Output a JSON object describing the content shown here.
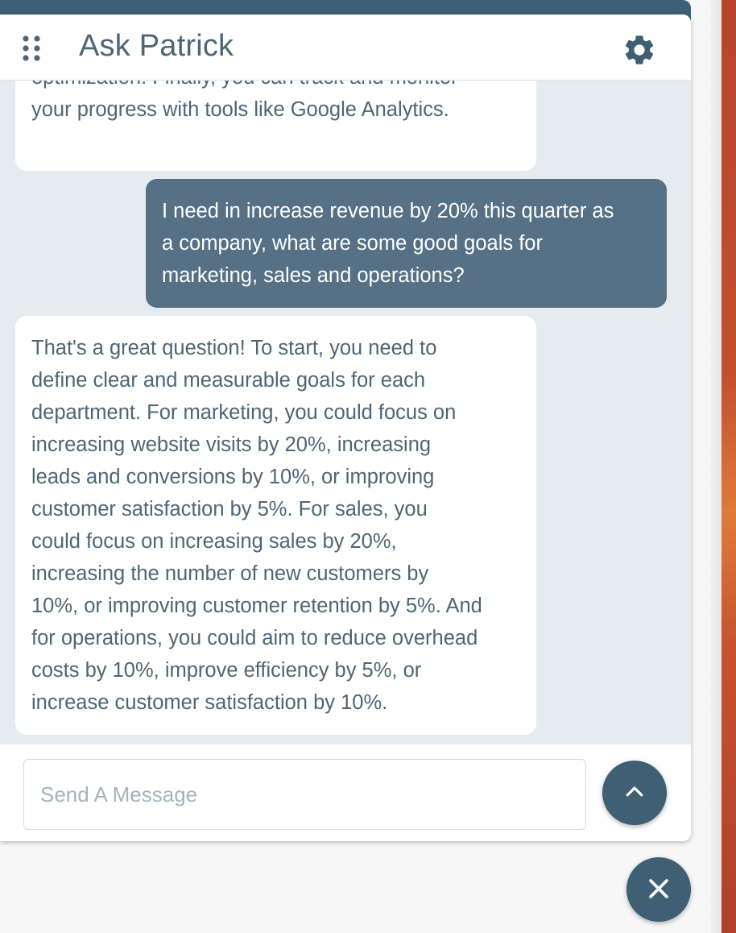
{
  "header": {
    "title": "Ask Patrick",
    "drag_icon": "drag-handle-icon",
    "settings_icon": "gear-icon"
  },
  "messages": [
    {
      "role": "bot",
      "partial": true,
      "lines": [
        "optimization. Finally, you can track and monitor",
        "your progress with tools like Google Analytics."
      ]
    },
    {
      "role": "user",
      "lines": [
        "I need in increase revenue by 20% this quarter as",
        "a company, what are some good goals for",
        "marketing, sales and operations?"
      ]
    },
    {
      "role": "bot",
      "lines": [
        "That's a great question! To start, you need to",
        "define clear and measurable goals for each",
        "department. For marketing, you could focus on",
        "increasing website visits by 20%, increasing",
        "leads and conversions by 10%, or improving",
        "customer satisfaction by 5%. For sales, you",
        "could focus on increasing sales by 20%,",
        "increasing the number of new customers by",
        "10%, or improving customer retention by 5%. And",
        "for operations, you could aim to reduce overhead",
        "costs by 10%, improve efficiency by 5%, or",
        "increase customer satisfaction by 10%."
      ]
    }
  ],
  "composer": {
    "placeholder": "Send A Message",
    "value": "",
    "send_icon": "chevron-up-icon"
  },
  "close_button": {
    "icon": "close-icon"
  },
  "colors": {
    "primary": "#3e5f74",
    "user_bubble": "#567085",
    "bot_text": "#4d6676",
    "chat_bg": "#e5ebef"
  }
}
